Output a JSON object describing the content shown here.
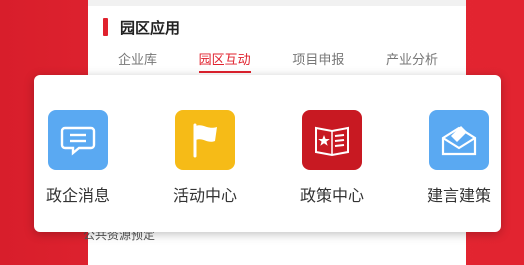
{
  "section": {
    "title": "园区应用",
    "tabs": [
      "企业库",
      "园区互动",
      "项目申报",
      "产业分析"
    ],
    "active_tab": "园区互动"
  },
  "partially_hidden_text": "公共资源预定",
  "popup": {
    "apps": [
      {
        "label": "政企消息",
        "icon": "chat-bubble-icon",
        "color": "#5aa9f2"
      },
      {
        "label": "活动中心",
        "icon": "flag-icon",
        "color": "#f6bb17"
      },
      {
        "label": "政策中心",
        "icon": "policy-document-icon",
        "color": "#c81922"
      },
      {
        "label": "建言建策",
        "icon": "envelope-icon",
        "color": "#5aa9f2"
      }
    ]
  },
  "colors": {
    "accent": "#e0222e",
    "background": "#e0222e"
  }
}
